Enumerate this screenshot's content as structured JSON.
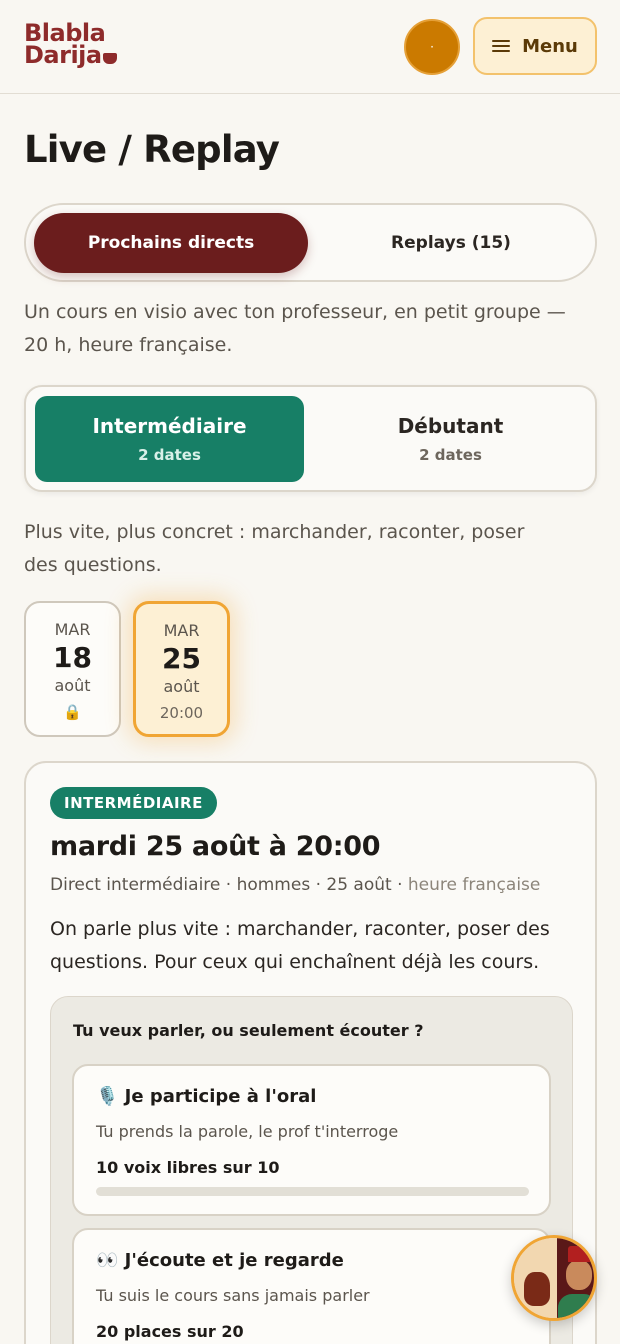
{
  "header": {
    "logo_line1": "Blabla",
    "logo_line2": "Darija",
    "avatar_initial": "·",
    "menu_label": "Menu"
  },
  "page": {
    "title": "Live / Replay"
  },
  "tabs": {
    "active": "Prochains directs",
    "inactive": "Replays (15)"
  },
  "intro": "Un cours en visio avec ton professeur, en petit groupe — 20 h, heure française.",
  "levels": [
    {
      "name": "Intermédiaire",
      "count": "2 dates",
      "selected": true
    },
    {
      "name": "Débutant",
      "count": "2 dates",
      "selected": false
    }
  ],
  "level_description": "Plus vite, plus concret : marchander, raconter, poser des questions.",
  "dates": [
    {
      "dow": "MAR",
      "day": "18",
      "month": "août",
      "extra": "🔒",
      "selected": false
    },
    {
      "dow": "MAR",
      "day": "25",
      "month": "août",
      "extra": "20:00",
      "selected": true
    }
  ],
  "session": {
    "badge": "INTERMÉDIAIRE",
    "title": "mardi 25 août à 20:00",
    "meta_main": "Direct intermédiaire · hommes · 25 août · ",
    "meta_muted": "heure française",
    "description": "On parle plus vite : marchander, raconter, poser des questions. Pour ceux qui enchaînent déjà les cours.",
    "choice_question": "Tu veux parler, ou seulement écouter ?",
    "options": [
      {
        "title": "🎙️ Je participe à l'oral",
        "subtitle": "Tu prends la parole, le prof t'interroge",
        "capacity": "10 voix libres sur 10",
        "fill": 0
      },
      {
        "title": "👀 J'écoute et je regarde",
        "subtitle": "Tu suis le cours sans jamais parler",
        "capacity": "20 places sur 20"
      }
    ]
  },
  "colors": {
    "brand": "#8e2b2b",
    "active_tab": "#6b1d1d",
    "level_green": "#177f66",
    "accent_orange": "#f0a534",
    "background": "#f9f7f2"
  },
  "icons": {
    "menu": "hamburger-icon",
    "lock": "lock-icon",
    "assistant": "assistant-avatar-icon"
  }
}
